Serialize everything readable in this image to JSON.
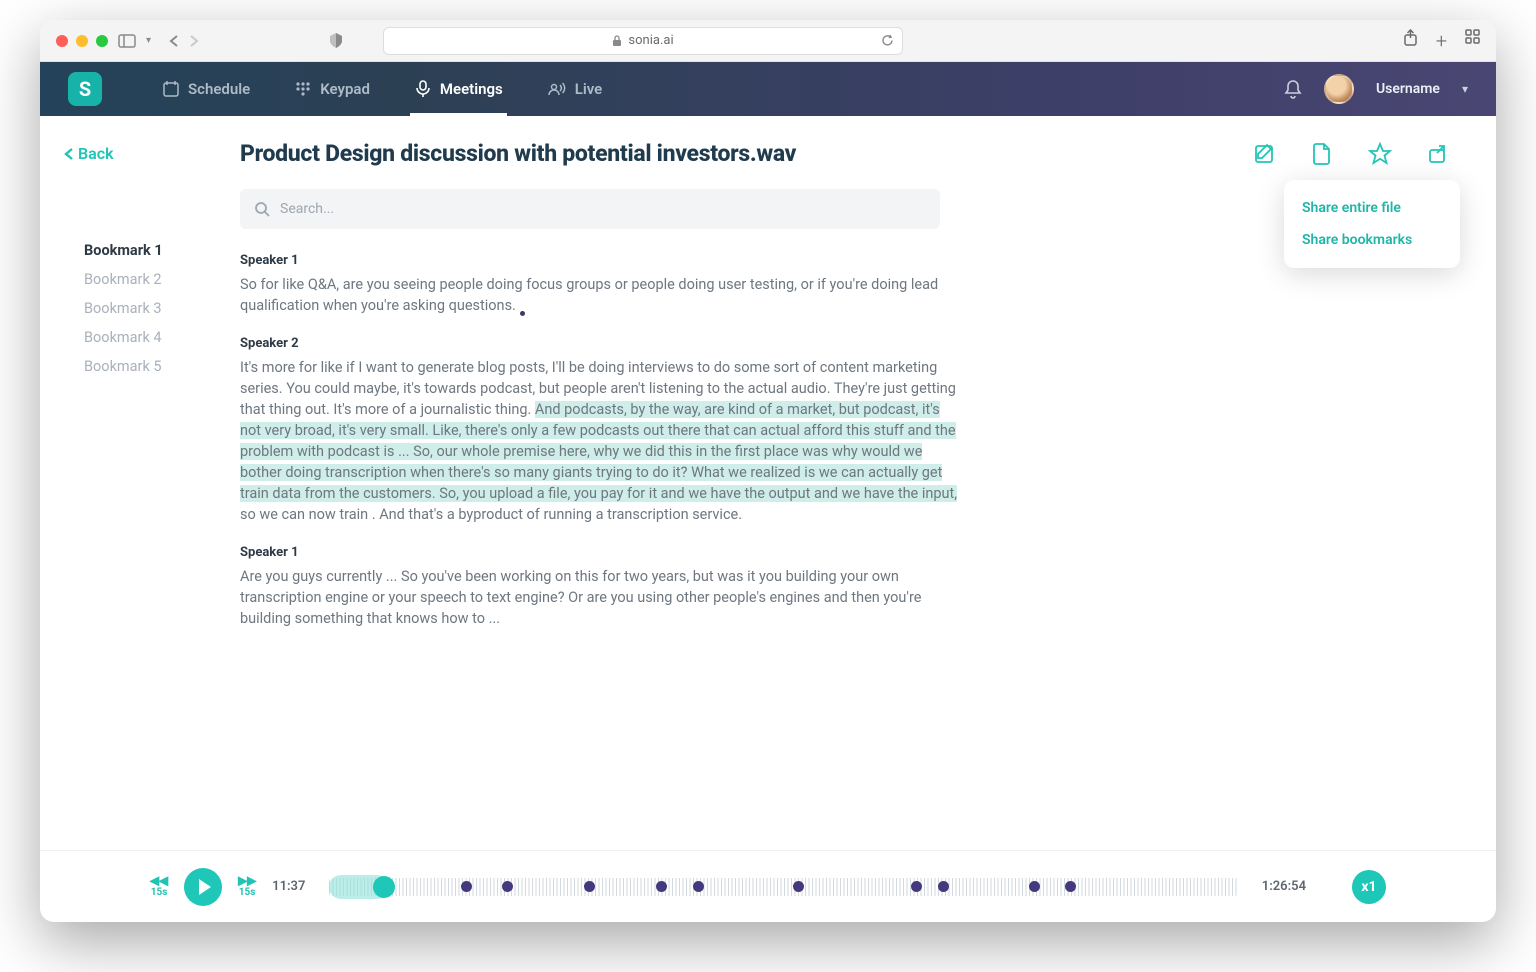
{
  "browser": {
    "url_host": "sonia.ai"
  },
  "nav": {
    "items": [
      {
        "label": "Schedule"
      },
      {
        "label": "Keypad"
      },
      {
        "label": "Meetings"
      },
      {
        "label": "Live"
      }
    ],
    "active_index": 2
  },
  "user": {
    "name": "Username"
  },
  "back": {
    "label": "Back"
  },
  "page": {
    "title": "Product Design discussion with potential investors.wav",
    "search_placeholder": "Search..."
  },
  "bookmarks": [
    {
      "label": "Bookmark 1",
      "active": true
    },
    {
      "label": "Bookmark 2",
      "active": false
    },
    {
      "label": "Bookmark 3",
      "active": false
    },
    {
      "label": "Bookmark 4",
      "active": false
    },
    {
      "label": "Bookmark 5",
      "active": false
    }
  ],
  "transcript": [
    {
      "speaker": "Speaker 1",
      "pre": "So for like Q&A, are you seeing people doing focus groups or people doing user  testing, or if you're doing lead qualification when you're asking questions.",
      "hl": "",
      "post": ""
    },
    {
      "speaker": "Speaker 2",
      "pre": "It's more for like if I want to generate blog posts, I'll be doing interviews  to do some sort of content marketing series. You could maybe, it's towards podcast, but  people aren't listening to the actual audio. They're just getting that thing out. It's more  of a journalistic thing. ",
      "hl": "And podcasts, by the way, are kind of a market, but podcast, it's not very broad, it's very small. Like, there's only a few podcasts out  there that can actual afford this stuff and the problem with podcast is ... So,  our whole premise here, why we did this in the first place was why would  we bother doing transcription when there's so many giants trying to do it? What we  realized is we can actually get train data from the customers. So, you upload a  file, you pay for it and we have the output and we have the input,",
      "post": "  so we can now train . And that's a byproduct of running a transcription service."
    },
    {
      "speaker": "Speaker 1",
      "pre": "Are you guys currently ... So you've been working on this for two years, but  was it you building your own transcription engine or your speech to text engine? Or  are you using other people's engines and then you're building something that knows how to  ...",
      "hl": "",
      "post": ""
    }
  ],
  "share_menu": {
    "entire": "Share entire file",
    "bookmarks": "Share bookmarks"
  },
  "player": {
    "skip_label": "15s",
    "current": "11:37",
    "duration": "1:26:54",
    "speed": "x1",
    "bookmark_positions_pct": [
      14.5,
      19,
      28,
      36,
      40,
      51,
      64,
      67,
      77,
      81
    ]
  }
}
